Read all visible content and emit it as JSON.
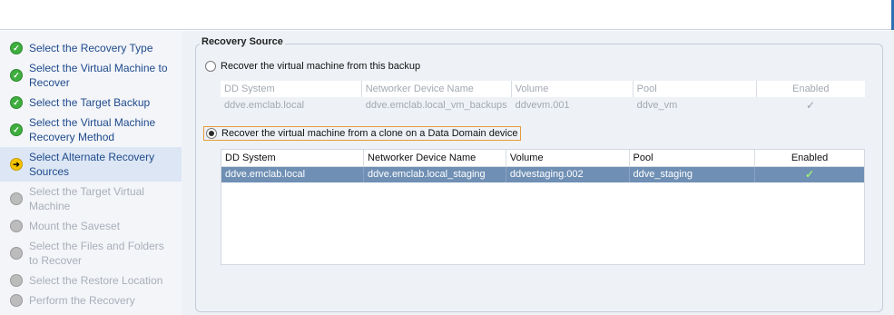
{
  "wizard": {
    "steps": [
      {
        "label": "Select the Recovery Type",
        "state": "done"
      },
      {
        "label": "Select the Virtual Machine to Recover",
        "state": "done"
      },
      {
        "label": "Select the Target Backup",
        "state": "done"
      },
      {
        "label": "Select the Virtual Machine Recovery Method",
        "state": "done"
      },
      {
        "label": "Select Alternate Recovery Sources",
        "state": "current"
      },
      {
        "label": "Select the Target Virtual Machine",
        "state": "pending"
      },
      {
        "label": "Mount the Saveset",
        "state": "pending"
      },
      {
        "label": "Select the Files and Folders to Recover",
        "state": "pending"
      },
      {
        "label": "Select the Restore Location",
        "state": "pending"
      },
      {
        "label": "Perform the Recovery",
        "state": "pending"
      }
    ]
  },
  "recovery_source": {
    "title": "Recovery Source",
    "option_backup": {
      "label": "Recover the virtual machine from this backup",
      "selected": false
    },
    "option_clone": {
      "label": "Recover the virtual machine from a clone on a Data Domain device",
      "selected": true
    },
    "columns": [
      "DD System",
      "Networker Device Name",
      "Volume",
      "Pool",
      "Enabled"
    ],
    "backup_table": {
      "rows": [
        {
          "dd_system": "ddve.emclab.local",
          "device": "ddve.emclab.local_vm_backups",
          "volume": "ddvevm.001",
          "pool": "ddve_vm",
          "enabled": "✓"
        }
      ]
    },
    "clone_table": {
      "rows": [
        {
          "dd_system": "ddve.emclab.local",
          "device": "ddve.emclab.local_staging",
          "volume": "ddvestaging.002",
          "pool": "ddve_staging",
          "enabled": "✓"
        }
      ]
    }
  },
  "colors": {
    "selected_row": "#6f8fb4",
    "step_done": "#3fae3f",
    "step_current": "#f5c400",
    "step_pending": "#bcbcbc",
    "link_text": "#1f4a8c"
  }
}
